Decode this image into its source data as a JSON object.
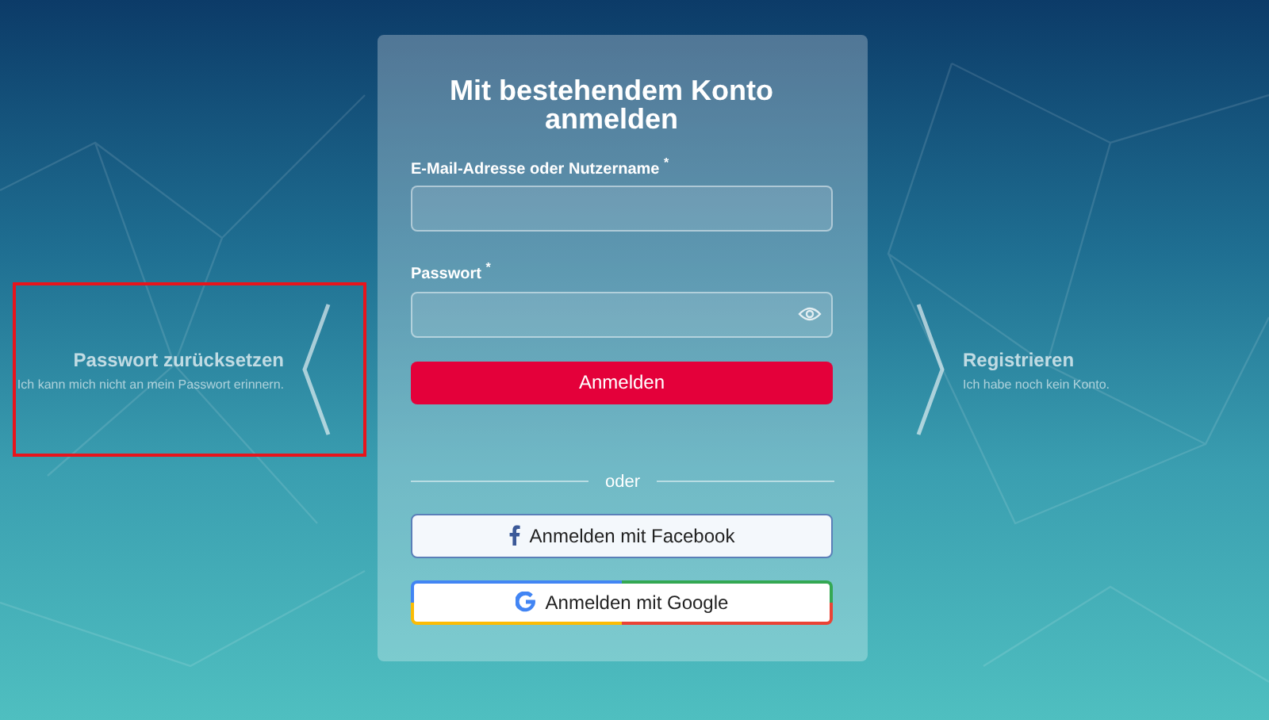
{
  "side_links": [
    {
      "kind": "reset",
      "title": "Passwort zurücksetzen",
      "subtitle": "Ich kann mich nicht an mein Passwort erinnern.",
      "highlighted": true
    },
    {
      "kind": "register",
      "title": "Registrieren",
      "subtitle": "Ich habe noch kein Konto.",
      "highlighted": false
    }
  ],
  "login": {
    "title": "Mit bestehendem Konto anmelden",
    "fields": [
      {
        "kind": "text",
        "label": "E-Mail-Adresse oder Nutzername $^{*}$"
      },
      {
        "kind": "password",
        "label": "Passwort $^{*}$"
      }
    ],
    "submit": "Anmelden",
    "divider": "oder",
    "social": [
      {
        "kind": "facebook",
        "label": "Anmelden mit Facebook"
      },
      {
        "kind": "google",
        "label": "Anmelden mit Google"
      }
    ]
  }
}
